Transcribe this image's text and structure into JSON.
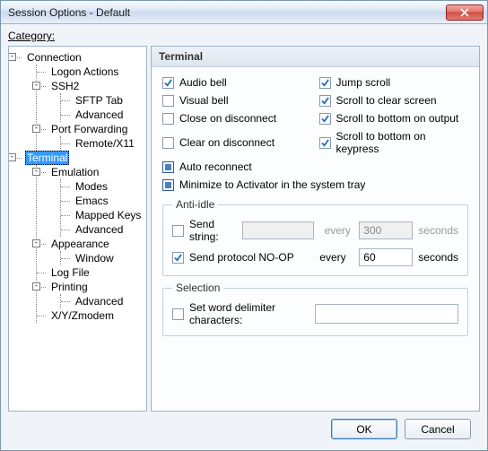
{
  "window": {
    "title": "Session Options - Default"
  },
  "category_label": "Category:",
  "tree": {
    "connection": "Connection",
    "logon_actions": "Logon Actions",
    "ssh2": "SSH2",
    "sftp_tab": "SFTP Tab",
    "advanced1": "Advanced",
    "port_forwarding": "Port Forwarding",
    "remote_x11": "Remote/X11",
    "terminal": "Terminal",
    "emulation": "Emulation",
    "modes": "Modes",
    "emacs": "Emacs",
    "mapped_keys": "Mapped Keys",
    "advanced2": "Advanced",
    "appearance": "Appearance",
    "window": "Window",
    "log_file": "Log File",
    "printing": "Printing",
    "advanced3": "Advanced",
    "xyz_modem": "X/Y/Zmodem"
  },
  "panel": {
    "header": "Terminal",
    "opts": {
      "audio_bell": "Audio bell",
      "jump_scroll": "Jump scroll",
      "visual_bell": "Visual bell",
      "scroll_clear": "Scroll to clear screen",
      "close_disc": "Close on disconnect",
      "scroll_output": "Scroll to bottom on output",
      "clear_disc": "Clear on disconnect",
      "scroll_keypress": "Scroll to bottom on keypress",
      "auto_reconnect": "Auto reconnect",
      "minimize_tray": "Minimize to Activator in the system tray"
    },
    "anti_idle": {
      "legend": "Anti-idle",
      "send_string": "Send string:",
      "send_string_val": "",
      "every1": "every",
      "int1": "300",
      "seconds1": "seconds",
      "send_noop": "Send protocol NO-OP",
      "every2": "every",
      "int2": "60",
      "seconds2": "seconds"
    },
    "selection": {
      "legend": "Selection",
      "word_delim": "Set word delimiter characters:",
      "word_delim_val": ""
    }
  },
  "buttons": {
    "ok": "OK",
    "cancel": "Cancel"
  }
}
